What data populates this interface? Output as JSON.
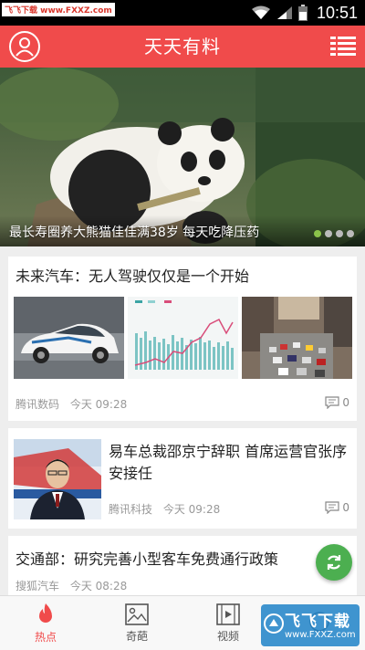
{
  "status_bar": {
    "watermark": "飞飞下载 www.FXXZ.com",
    "time": "10:51"
  },
  "header": {
    "title": "天天有料"
  },
  "banner": {
    "caption": "最长寿圈养大熊猫佳佳满38岁 每天吃降压药",
    "active_dot": 1,
    "dot_count": 4
  },
  "feed": [
    {
      "title": "未来汽车：无人驾驶仅仅是一个开始",
      "source": "腾讯数码",
      "time": "今天 09:28",
      "comments": "0"
    },
    {
      "title": "易车总裁邵京宁辞职 首席运营官张序安接任",
      "source": "腾讯科技",
      "time": "今天 09:28",
      "comments": "0"
    },
    {
      "title": "交通部：研究完善小型客车免费通行政策",
      "source": "搜狐汽车",
      "time": "今天 08:28"
    }
  ],
  "bottom_nav": {
    "items": [
      {
        "label": "热点",
        "icon": "flame-icon"
      },
      {
        "label": "奇葩",
        "icon": "image-icon"
      },
      {
        "label": "视频",
        "icon": "film-icon"
      },
      {
        "label": "",
        "icon": "more-icon"
      }
    ],
    "active_index": 0
  },
  "watermark_bottom": {
    "text": "飞飞下载",
    "url": "www.FXXZ.com"
  },
  "colors": {
    "primary": "#f04b4b",
    "dot_active": "#8bc34a",
    "fab": "#4caf50"
  }
}
